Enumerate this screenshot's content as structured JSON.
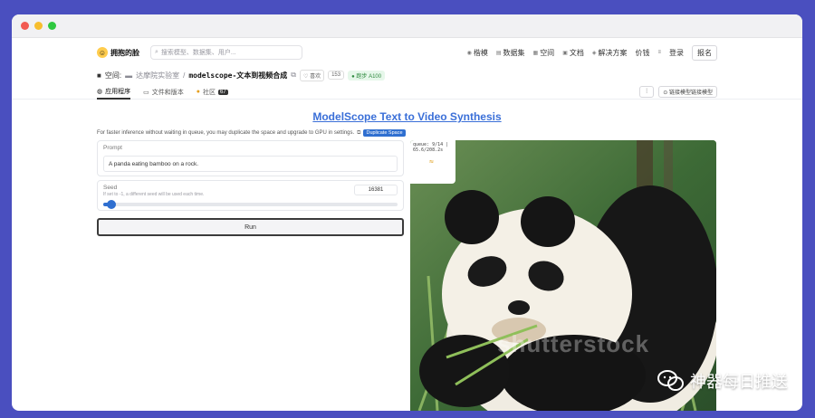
{
  "navbar": {
    "brand": "拥抱的脸",
    "search_placeholder": "搜索模型、数据集、用户...",
    "links": [
      {
        "label": "楷模"
      },
      {
        "label": "数据集"
      },
      {
        "label": "空间"
      },
      {
        "label": "文档"
      },
      {
        "label": "解决方案"
      },
      {
        "label": "价钱"
      }
    ],
    "login": "登录",
    "signup": "报名"
  },
  "space": {
    "prefix": "空间:",
    "owner": "达摩院实验室",
    "separator": "/",
    "name": "modelscope-文本到视频合成",
    "like_label": "喜欢",
    "like_count": "153",
    "status": "跑步 A100"
  },
  "tabs": {
    "items": [
      {
        "label": "应用程序"
      },
      {
        "label": "文件和版本"
      },
      {
        "label": "社区",
        "badge": "67"
      }
    ],
    "right_btn": "链接模型链接模型"
  },
  "app": {
    "title": "ModelScope Text to Video Synthesis",
    "notice": "For faster inference without waiting in queue, you may duplicate the space and upgrade to GPU in settings.",
    "duplicate_label": "Duplicate Space",
    "prompt_label": "Prompt",
    "prompt_value": "A panda eating bamboo on a rock.",
    "seed_label": "Seed",
    "seed_hint": "If set to -1, a different seed will be used each time.",
    "seed_value": "16381",
    "seed_fraction": 0.02,
    "run_label": "Run",
    "queue_line1": "queue: 9/14 |",
    "queue_line2": "65.6/208.2s",
    "watermark": "shutterstock"
  },
  "overlay": {
    "channel": "神器每日推送"
  },
  "colors": {
    "accent": "#2f6fd0",
    "link": "#3a6fd8",
    "background": "#4a4fbf"
  }
}
